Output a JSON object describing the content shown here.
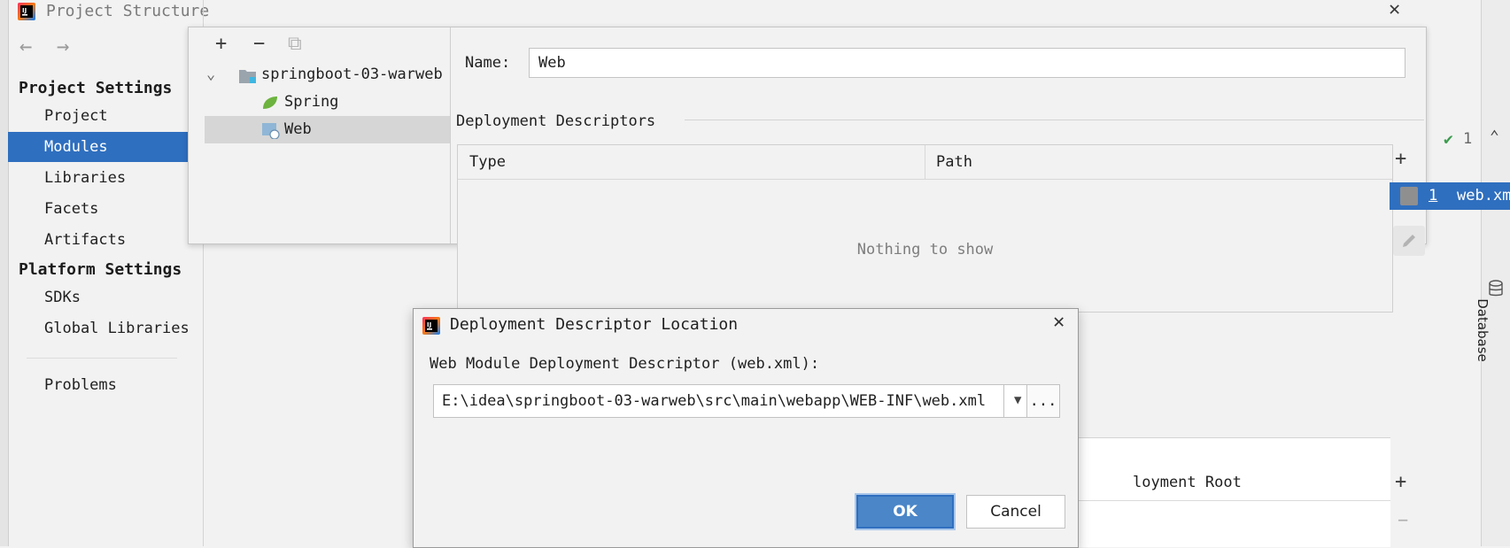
{
  "window": {
    "title": "Project Structure",
    "nav_back": "←",
    "nav_forward": "→",
    "close_glyph": "✕"
  },
  "sidebar": {
    "project_settings_header": "Project Settings",
    "platform_settings_header": "Platform Settings",
    "items": [
      {
        "label": "Project",
        "selected": false
      },
      {
        "label": "Modules",
        "selected": true
      },
      {
        "label": "Libraries",
        "selected": false
      },
      {
        "label": "Facets",
        "selected": false
      },
      {
        "label": "Artifacts",
        "selected": false
      }
    ],
    "platform_items": [
      {
        "label": "SDKs"
      },
      {
        "label": "Global Libraries"
      }
    ],
    "problems_label": "Problems"
  },
  "module_tree": {
    "toolbar": {
      "add": "+",
      "remove": "−",
      "copy": "⧉"
    },
    "root": {
      "label": "springboot-03-warweb",
      "expander": "⌄"
    },
    "children": [
      {
        "label": "Spring",
        "icon": "spring-leaf-icon"
      },
      {
        "label": "Web",
        "icon": "web-facet-icon",
        "selected": true
      }
    ]
  },
  "facet_editor": {
    "name_label": "Name:",
    "name_value": "Web",
    "deployment_descriptors_title": "Deployment Descriptors",
    "columns": [
      "Type",
      "Path"
    ],
    "empty_text": "Nothing to show",
    "add_glyph": "+",
    "lower_table_header": "loyment Root",
    "lower_add_glyph": "+",
    "lower_remove_glyph": "−"
  },
  "right_partial": {
    "check_glyph": "✔",
    "inspection_count": "1",
    "chevron": "⌃",
    "xml_row_num": "1",
    "xml_row_name": "web.xm",
    "tool_window_label": "Database"
  },
  "dialog": {
    "title": "Deployment Descriptor Location",
    "close_glyph": "✕",
    "field_label": "Web Module Deployment Descriptor (web.xml):",
    "path_value": "E:\\idea\\springboot-03-warweb\\src\\main\\webapp\\WEB-INF\\web.xml",
    "dropdown_glyph": "▼",
    "browse_label": "...",
    "ok_label": "OK",
    "cancel_label": "Cancel"
  },
  "colors": {
    "selection": "#2f6fbf",
    "ok_button": "#4a86c8",
    "spring_green": "#6db33f",
    "background": "#f2f2f2"
  }
}
